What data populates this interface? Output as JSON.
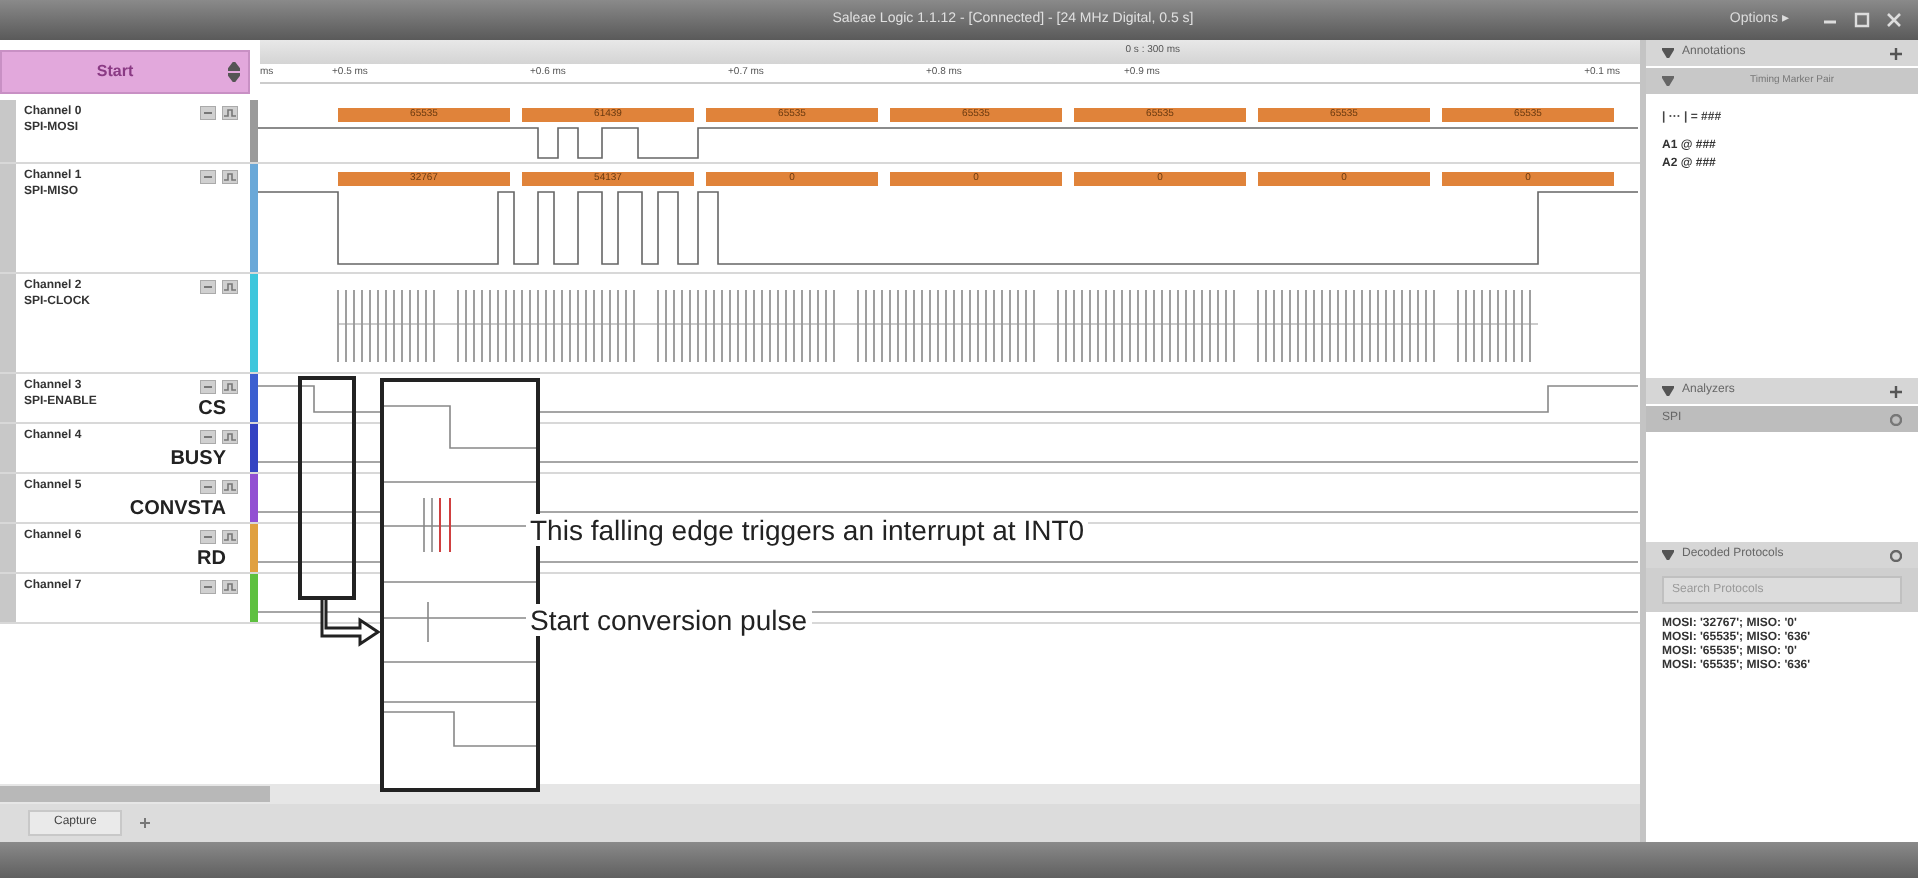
{
  "window": {
    "title": "Saleae Logic 1.1.12 - [Connected] - [24 MHz Digital, 0.5 s]",
    "options": "Options ▸"
  },
  "start_button": {
    "label": "Start"
  },
  "ruler": {
    "cursor": "0 s : 300 ms",
    "ticks": [
      "ms",
      "+0.5 ms",
      "+0.6 ms",
      "+0.7 ms",
      "+0.8 ms",
      "+0.9 ms",
      "+0.1 ms"
    ]
  },
  "channels": [
    {
      "name": "Channel 0",
      "label": "SPI-MOSI",
      "kind": "bus",
      "color": "#9a9a9a",
      "bus_labels": [
        "65535",
        "61439",
        "65535",
        "65535",
        "65535",
        "65535",
        "65535"
      ]
    },
    {
      "name": "Channel 1",
      "label": "SPI-MISO",
      "kind": "bus",
      "color": "#6aa8d8",
      "bus_labels": [
        "32767",
        "54137",
        "0",
        "0",
        "0",
        "0",
        "0"
      ]
    },
    {
      "name": "Channel 2",
      "label": "SPI-CLOCK",
      "kind": "clock",
      "color": "#3ec6dc"
    },
    {
      "name": "Channel 3",
      "label": "SPI-ENABLE",
      "annotation": "CS",
      "kind": "line",
      "color": "#3b5fd0"
    },
    {
      "name": "Channel 4",
      "annotation": "BUSY",
      "kind": "line",
      "color": "#3443c2"
    },
    {
      "name": "Channel 5",
      "annotation": "CONVSTA",
      "kind": "line",
      "color": "#9250d2"
    },
    {
      "name": "Channel 6",
      "annotation": "RD",
      "kind": "line",
      "color": "#e0a040"
    },
    {
      "name": "Channel 7",
      "kind": "line",
      "color": "#5ec040"
    }
  ],
  "callouts": [
    {
      "text": "This falling edge triggers an interrupt at INT0"
    },
    {
      "text": "Start conversion pulse"
    }
  ],
  "side_panel": {
    "annotations": {
      "title": "Annotations",
      "marker_pair": "Timing Marker Pair",
      "measure": "|  ···  | = ###",
      "markers": [
        "A1 @ ###",
        "A2 @ ###"
      ]
    },
    "analyzers": {
      "title": "Analyzers",
      "items": [
        "SPI"
      ]
    },
    "decoded": {
      "title": "Decoded Protocols",
      "placeholder": "Search Protocols",
      "rows": [
        "MOSI: '32767'; MISO: '0'",
        "MOSI: '65535'; MISO: '636'",
        "MOSI: '65535'; MISO: '0'",
        "MOSI: '65535'; MISO: '636'"
      ]
    }
  },
  "tabs": [
    {
      "label": "Capture",
      "selected": true
    }
  ]
}
